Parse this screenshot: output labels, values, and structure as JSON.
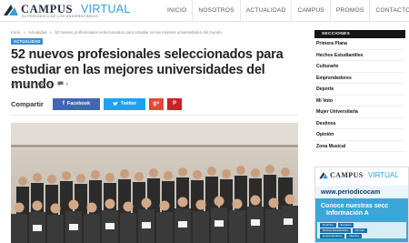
{
  "brand": {
    "name_part1": "CAMPUS",
    "name_part2": "VIRTUAL",
    "tagline": "EL PERIÓDICO DE LOS UNIVERSITARIOS"
  },
  "nav": {
    "items": [
      "INICIO",
      "NOSOTROS",
      "ACTUALIDAD",
      "CAMPUS",
      "PROMOS",
      "CONTACTO"
    ]
  },
  "breadcrumb": {
    "home": "Inicio",
    "sep1": "»",
    "section": "Actualidad",
    "sep2": "»",
    "current": "52 nuevos profesionales seleccionados para estudiar en las mejores universidades del mundo"
  },
  "article": {
    "category": "ACTUALIDAD",
    "title": "52 nuevos profesionales seleccionados para estudiar en las mejores universidades del mundo",
    "date": "ago 4, 2015",
    "views": "24",
    "comments": "0"
  },
  "share": {
    "label": "Compartir",
    "facebook": "Facebook",
    "twitter": "Twitter",
    "googleplus": "g+",
    "pinterest": "P"
  },
  "sidebar": {
    "heading": "SECCIONES",
    "items": [
      "Primera Plana",
      "Hechos Estudiantiles",
      "Culturarte",
      "Emprendedores",
      "Deporte",
      "Mi Voto",
      "Mujer Universitaria",
      "Destinos",
      "Opinión",
      "Zona Musical"
    ]
  },
  "ad": {
    "brand_part1": "CAMPUS",
    "brand_part2": "VIRTUAL",
    "url": "www.periodicocam",
    "line1": "Conoce nuestras secc",
    "line2": "Información A",
    "chips_row1": [
      "Destinos",
      "Empleos"
    ],
    "chips_row2": [
      "Hechos Estudiantiles",
      "Mi Voto"
    ],
    "chips_row3": [
      "Emprendedores",
      "Deporte"
    ]
  },
  "colors": {
    "accent": "#3a8fd1",
    "brand_dark": "#1f2a44",
    "brand_light": "#2fa0d8",
    "facebook": "#4267b2",
    "twitter": "#1da1f2",
    "googleplus": "#dd4b39",
    "pinterest": "#cb2027"
  }
}
